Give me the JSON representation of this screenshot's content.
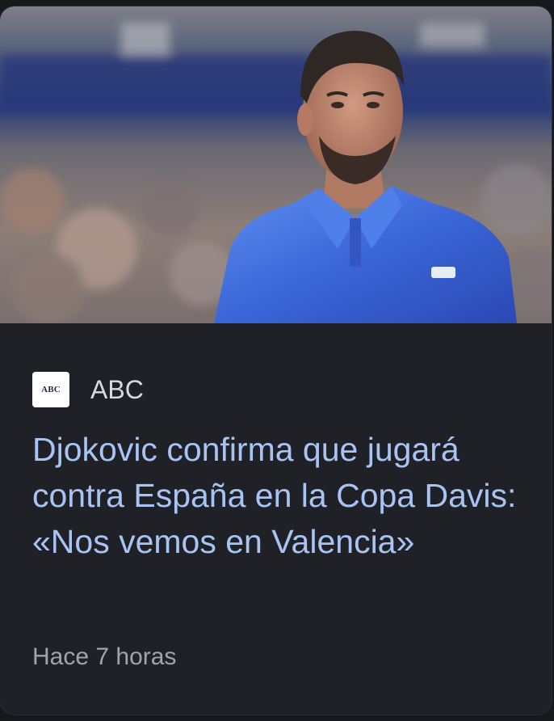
{
  "article": {
    "image_alt": "Djokovic in blue polo at tennis stadium",
    "source": {
      "logo_text": "ABC",
      "name": "ABC"
    },
    "headline": "Djokovic confirma que jugará contra España en la Copa Davis: «Nos vemos en Valencia»",
    "timestamp": "Hace 7 horas"
  },
  "colors": {
    "card_bg": "#202126",
    "page_bg": "#17181c",
    "headline": "#a7c4f5",
    "source_name": "#d9dadd",
    "timestamp": "#a2a4a9",
    "shirt_blue": "#3f6fe0"
  }
}
